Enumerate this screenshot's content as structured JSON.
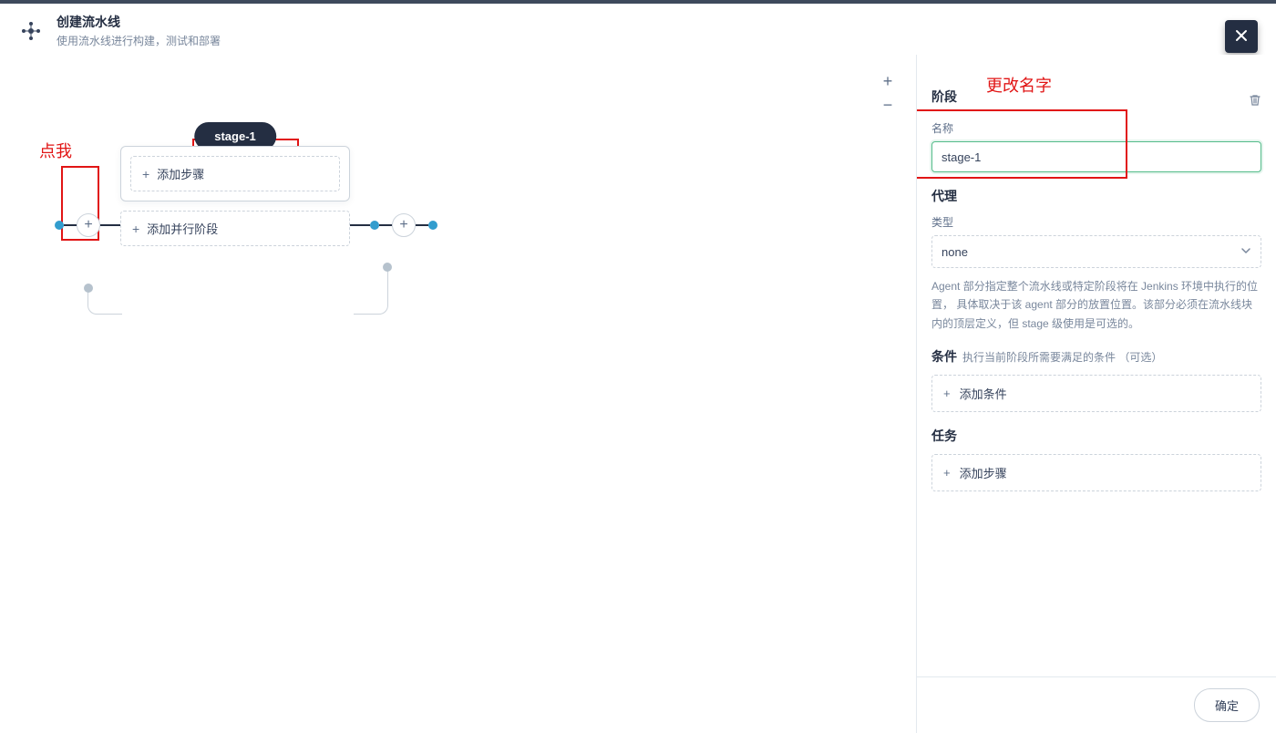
{
  "header": {
    "title": "创建流水线",
    "subtitle": "使用流水线进行构建，测试和部署"
  },
  "canvas": {
    "stage_name": "stage-1",
    "add_step_label": "添加步骤",
    "add_parallel_label": "添加并行阶段"
  },
  "panel": {
    "section_stage": "阶段",
    "name_label": "名称",
    "name_value": "stage-1",
    "agent_section": "代理",
    "type_label": "类型",
    "type_value": "none",
    "agent_desc": "Agent 部分指定整个流水线或特定阶段将在 Jenkins 环境中执行的位置， 具体取决于该 agent 部分的放置位置。该部分必须在流水线块内的顶层定义，但 stage 级使用是可选的。",
    "conditions_section": "条件",
    "conditions_hint": "执行当前阶段所需要满足的条件 （可选）",
    "add_condition_label": "添加条件",
    "tasks_section": "任务",
    "add_step_panel_label": "添加步骤",
    "ok_label": "确定"
  },
  "annotations": {
    "click_me": "点我",
    "change_name": "更改名字"
  }
}
